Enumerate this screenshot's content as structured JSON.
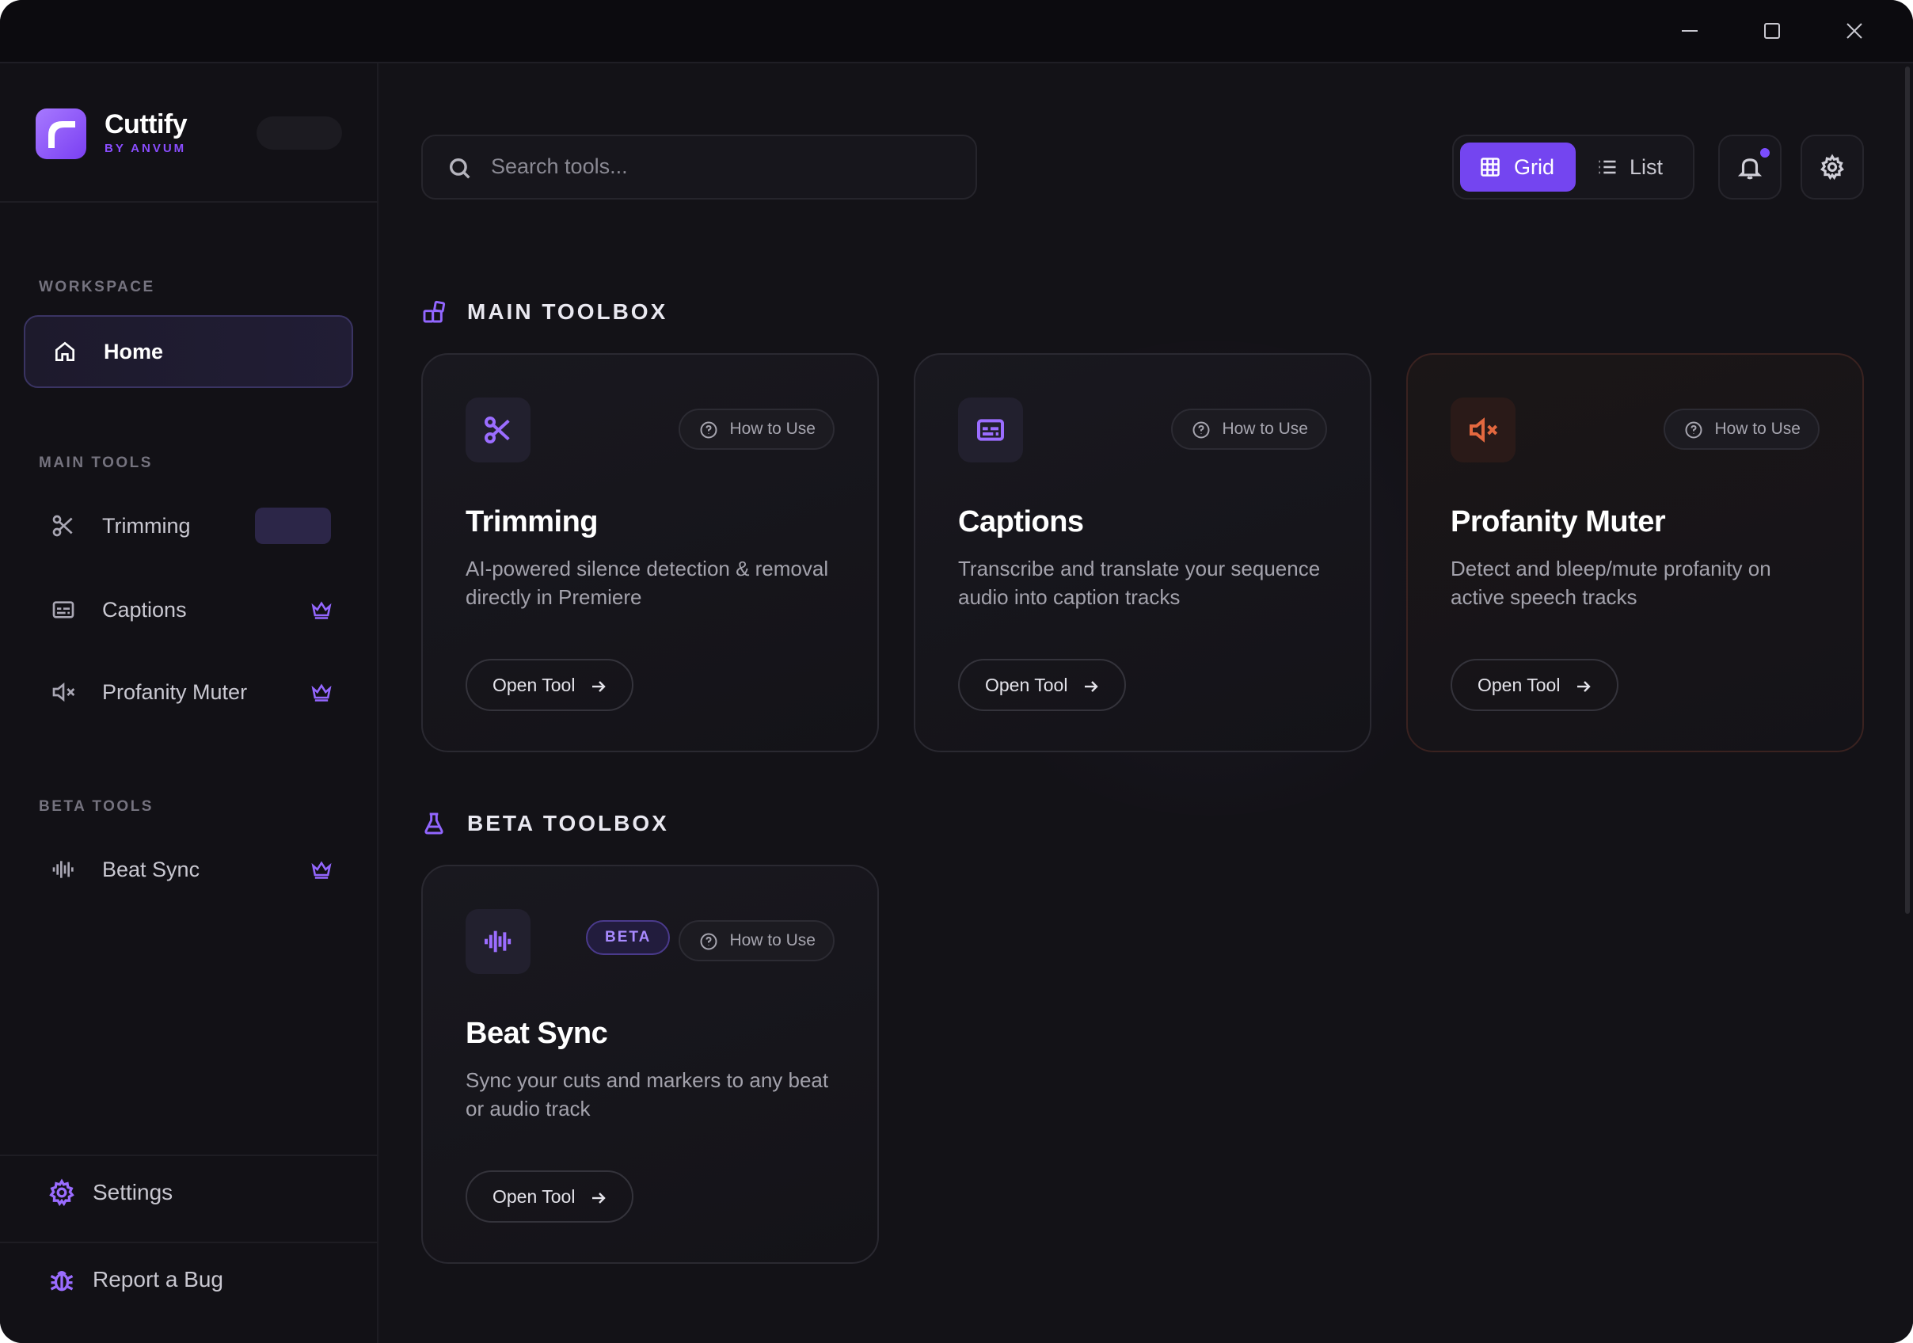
{
  "window_controls": {
    "minimize": "minimize-icon",
    "maximize": "maximize-icon",
    "close": "close-icon"
  },
  "brand": {
    "name": "Cuttify",
    "subtitle": "BY ANVUM",
    "accent": "#8a4dff"
  },
  "sidebar": {
    "workspace_label": "WORKSPACE",
    "home_label": "Home",
    "main_tools_label": "MAIN TOOLS",
    "main_tools": [
      {
        "label": "Trimming",
        "icon": "scissors-icon"
      },
      {
        "label": "Captions",
        "icon": "captions-icon"
      },
      {
        "label": "Profanity Muter",
        "icon": "mute-icon"
      }
    ],
    "beta_tools_label": "BETA TOOLS",
    "beta_tools": [
      {
        "label": "Beat Sync",
        "icon": "waveform-icon"
      }
    ],
    "settings_label": "Settings",
    "report_bug_label": "Report a Bug"
  },
  "header": {
    "search_placeholder": "Search tools...",
    "view_grid_label": "Grid",
    "view_list_label": "List",
    "active_view": "Grid"
  },
  "main_toolbox": {
    "title": "MAIN TOOLBOX",
    "cards": [
      {
        "title": "Trimming",
        "description": "AI-powered silence detection & removal directly in Premiere",
        "how_to": "How to Use",
        "open": "Open Tool"
      },
      {
        "title": "Captions",
        "description": "Transcribe and translate your sequence audio into caption tracks",
        "how_to": "How to Use",
        "open": "Open Tool"
      },
      {
        "title": "Profanity Muter",
        "description": "Detect and bleep/mute profanity on active speech tracks",
        "how_to": "How to Use",
        "open": "Open Tool"
      }
    ]
  },
  "beta_toolbox": {
    "title": "BETA TOOLBOX",
    "cards": [
      {
        "title": "Beat Sync",
        "badge": "BETA",
        "description": "Sync your cuts and markers to any beat or audio track",
        "how_to": "How to Use",
        "open": "Open Tool"
      }
    ]
  },
  "colors": {
    "accent": "#7445f0",
    "warm_accent": "#e3683f",
    "background": "#131217"
  }
}
